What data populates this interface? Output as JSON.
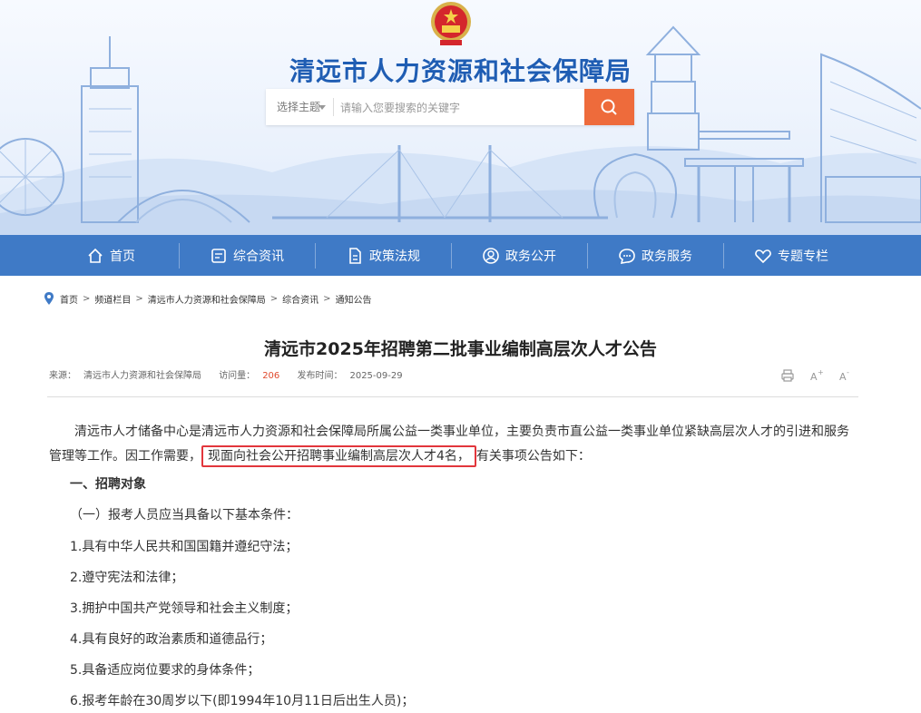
{
  "header": {
    "site_title": "清远市人力资源和社会保障局",
    "search": {
      "topic_label": "选择主题",
      "placeholder": "请输入您要搜索的关键字",
      "value": ""
    }
  },
  "nav": {
    "items": [
      {
        "label": "首页",
        "icon": "home-icon"
      },
      {
        "label": "综合资讯",
        "icon": "news-icon"
      },
      {
        "label": "政策法规",
        "icon": "document-icon"
      },
      {
        "label": "政务公开",
        "icon": "user-icon"
      },
      {
        "label": "政务服务",
        "icon": "chat-icon"
      },
      {
        "label": "专题专栏",
        "icon": "heart-icon"
      }
    ]
  },
  "breadcrumb": [
    "首页",
    "频道栏目",
    "清远市人力资源和社会保障局",
    "综合资讯",
    "通知公告"
  ],
  "article": {
    "title": "清远市2025年招聘第二批事业编制高层次人才公告",
    "source_label": "来源：",
    "source": "清远市人力资源和社会保障局",
    "views_label": "访问量：",
    "views": "206",
    "date_label": "发布时间：",
    "date": "2025-09-29",
    "p1_a": "清远市人才储备中心是清远市人力资源和社会保障局所属公益一类事业单位，主要负责市直公益一类事业单位紧缺高层次人才的引进和服务管理等工作。因工作需要，",
    "p1_highlight": "现面向社会公开招聘事业编制高层次人才4名，",
    "p1_b": "有关事项公告如下：",
    "section1": "一、招聘对象",
    "sub1": "（一）报考人员应当具备以下基本条件：",
    "items": [
      "1.具有中华人民共和国国籍并遵纪守法；",
      "2.遵守宪法和法律；",
      "3.拥护中国共产党领导和社会主义制度；",
      "4.具有良好的政治素质和道德品行；",
      "5.具备适应岗位要求的身体条件；",
      "6.报考年龄在30周岁以下(即1994年10月11日后出生人员)；"
    ]
  },
  "colors": {
    "nav": "#3f7ac6",
    "title": "#1f5db3",
    "search_button": "#ee6b3b",
    "highlight_border": "#e2363c",
    "views": "#e04a2e"
  }
}
